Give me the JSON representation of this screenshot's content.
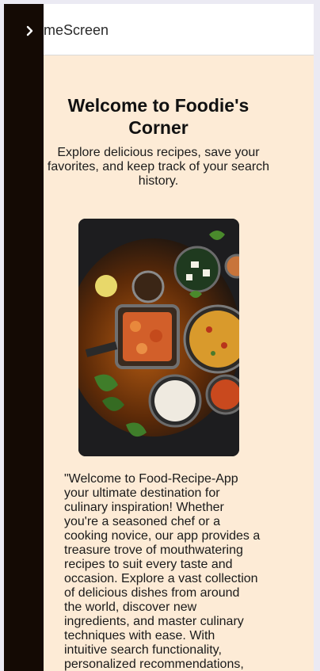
{
  "header": {
    "title": "HomeScreen"
  },
  "drawer": {
    "toggle_icon": "chevron-right-icon"
  },
  "main": {
    "title": "Welcome to Foodie's Corner",
    "subtitle": "Explore delicious recipes, save your favorites, and keep track of your search history.",
    "hero_image_icon": "food-dishes-photo",
    "description": "\"Welcome to Food-Recipe-App your ultimate destination for culinary inspiration! Whether you're a seasoned chef or a cooking novice, our app provides a treasure trove of mouthwatering recipes to suit every taste and occasion. Explore a vast collection of delicious dishes from around the world, discover new ingredients, and master culinary techniques with ease. With intuitive search functionality, personalized recommendations, and the ability"
  },
  "colors": {
    "drawer": "#140a04",
    "content_bg": "#fdebd6",
    "header_bg": "#ffffff",
    "page_bg": "#ebeaf3"
  }
}
